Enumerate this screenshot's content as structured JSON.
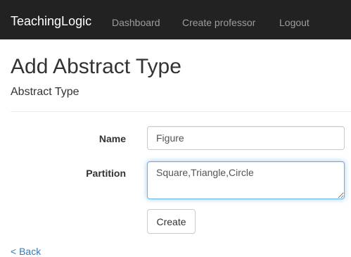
{
  "navbar": {
    "brand": "TeachingLogic",
    "links": [
      "Dashboard",
      "Create professor",
      "Logout"
    ]
  },
  "header": {
    "title": "Add Abstract Type",
    "subtitle": "Abstract Type"
  },
  "form": {
    "name_label": "Name",
    "name_value": "Figure",
    "partition_label": "Partition",
    "partition_value": "Square,Triangle,Circle",
    "submit_label": "Create"
  },
  "footer": {
    "back_label": "< Back"
  },
  "colors": {
    "navbar_bg": "#222222",
    "link": "#337ab7",
    "focus_border": "#66afe9"
  }
}
